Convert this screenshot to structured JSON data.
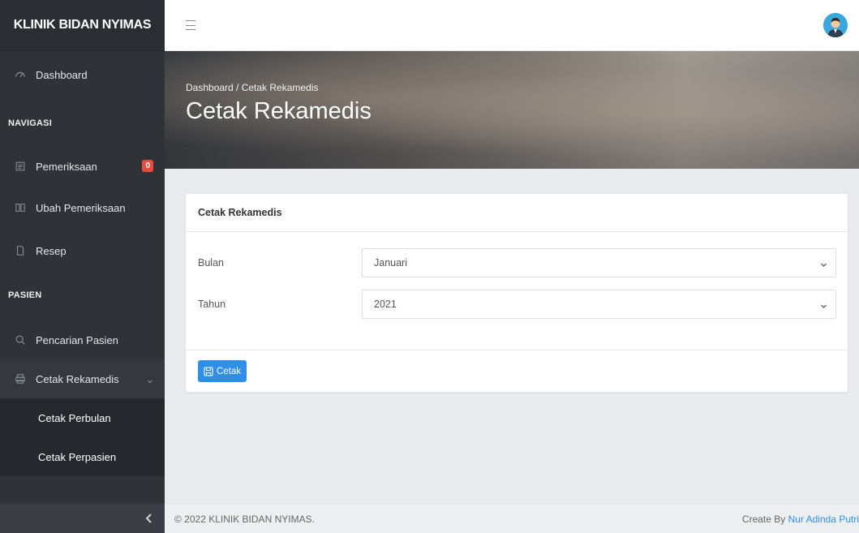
{
  "sidebar": {
    "brand": "KLINIK BIDAN NYIMAS",
    "dashboard": {
      "label": "Dashboard",
      "icon": "dashboard-icon"
    },
    "section_navigasi": "NAVIGASI",
    "pemeriksaan": {
      "label": "Pemeriksaan",
      "badge": "0",
      "icon": "clipboard-icon"
    },
    "ubah_pemeriksaan": {
      "label": "Ubah Pemeriksaan",
      "icon": "book-icon"
    },
    "resep": {
      "label": "Resep",
      "icon": "file-icon"
    },
    "section_pasien": "PASIEN",
    "pencarian_pasien": {
      "label": "Pencarian Pasien",
      "icon": "search-icon"
    },
    "cetak_rekamedis": {
      "label": "Cetak Rekamedis",
      "icon": "printer-icon"
    },
    "submenu": [
      "Cetak Perbulan",
      "Cetak Perpasien"
    ],
    "collapse_icon": "chevron-left-icon"
  },
  "header": {
    "menu_icon": "hamburger-icon",
    "avatar_icon": "user-avatar-icon"
  },
  "hero": {
    "breadcrumb": "Dashboard / Cetak Rekamedis",
    "title": "Cetak Rekamedis"
  },
  "card": {
    "title": "Cetak Rekamedis",
    "bulan_label": "Bulan",
    "bulan_value": "Januari",
    "tahun_label": "Tahun",
    "tahun_value": "2021",
    "button_label": "Cetak"
  },
  "footer": {
    "copyright": "© 2022 KLINIK BIDAN NYIMAS.",
    "created_by": "Create By ",
    "author": "Nur Adinda Putri"
  },
  "colors": {
    "sidebar": "#2f3338",
    "primary": "#2f8ee6",
    "badge": "#e74c3c"
  }
}
